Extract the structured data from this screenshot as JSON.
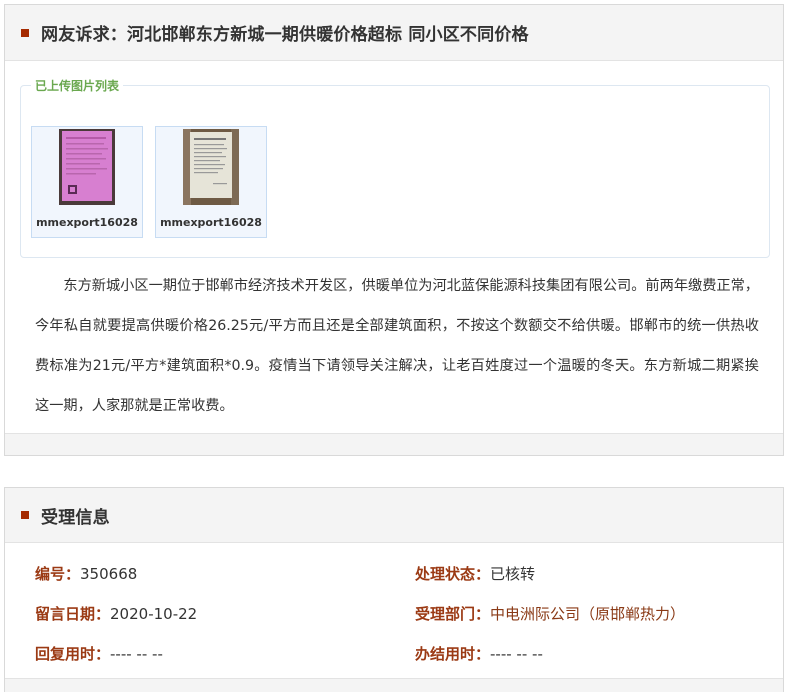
{
  "complaint": {
    "title": "网友诉求：河北邯郸东方新城一期供暖价格超标 同小区不同价格",
    "uploads_legend": "已上传图片列表",
    "images": [
      {
        "name": "mmexport16028"
      },
      {
        "name": "mmexport16028"
      }
    ],
    "content": "东方新城小区一期位于邯郸市经济技术开发区，供暖单位为河北蓝保能源科技集团有限公司。前两年缴费正常，今年私自就要提高供暖价格26.25元/平方而且还是全部建筑面积，不按这个数额交不给供暖。邯郸市的统一供热收费标准为21元/平方*建筑面积*0.9。疫情当下请领导关注解决，让老百姓度过一个温暖的冬天。东方新城二期紧挨这一期，人家那就是正常收费。"
  },
  "acceptance": {
    "title": "受理信息",
    "number_label": "编号：",
    "number": "350668",
    "status_label": "处理状态：",
    "status": "已核转",
    "date_label": "留言日期：",
    "date": "2020-10-22",
    "dept_label": "受理部门：",
    "dept": "中电洲际公司（原邯郸热力）",
    "reply_label": "回复用时：",
    "reply": "---- -- --",
    "finish_label": "办结用时：",
    "finish": "---- -- --"
  },
  "colors": {
    "marker": "#a52a00",
    "label": "#9b3a14",
    "legend": "#6aa84f"
  }
}
